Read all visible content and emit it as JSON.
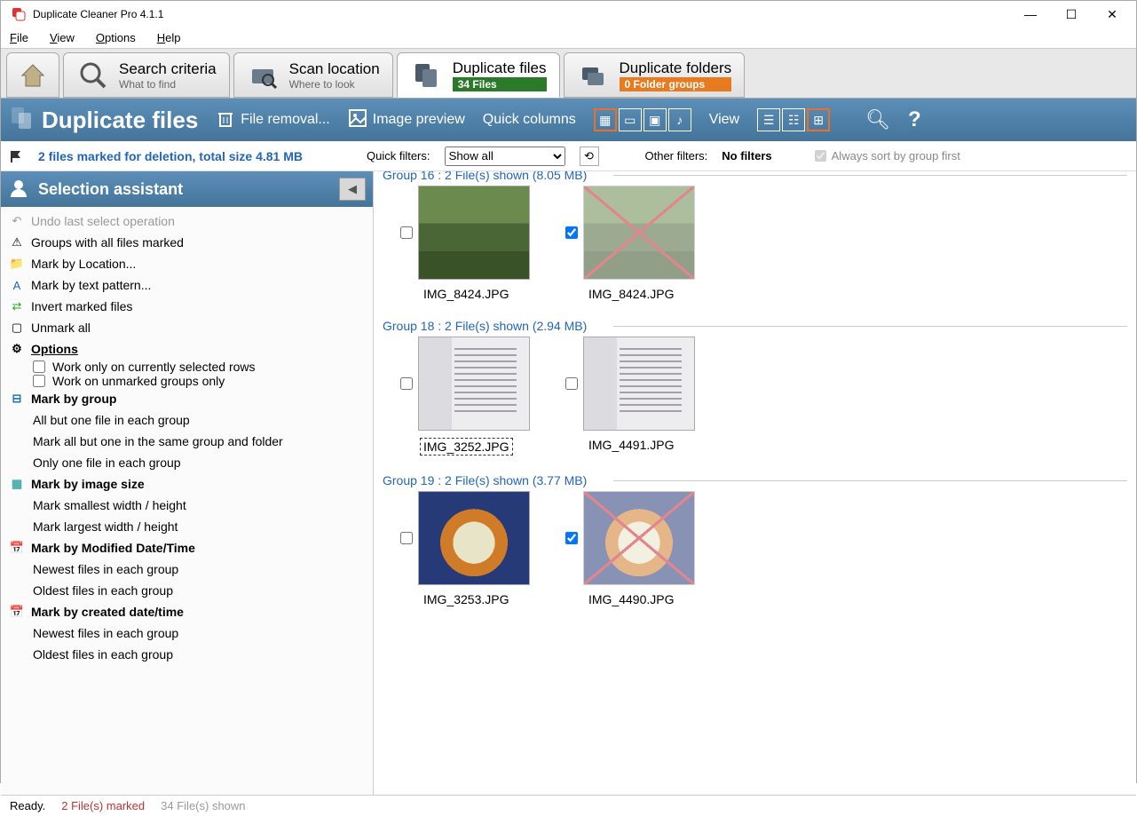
{
  "window": {
    "title": "Duplicate Cleaner Pro 4.1.1"
  },
  "menu": {
    "file": "File",
    "view": "View",
    "options": "Options",
    "help": "Help"
  },
  "tabs": {
    "search": {
      "title": "Search criteria",
      "sub": "What to find"
    },
    "scan": {
      "title": "Scan location",
      "sub": "Where to look"
    },
    "dupfiles": {
      "title": "Duplicate files",
      "badge": "34 Files"
    },
    "dupfolders": {
      "title": "Duplicate folders",
      "badge": "0 Folder groups"
    }
  },
  "bluebar": {
    "title": "Duplicate files",
    "file_removal": "File removal...",
    "image_preview": "Image preview",
    "quick_columns": "Quick columns",
    "view": "View"
  },
  "filterbar": {
    "marked": "2 files marked for deletion, total size 4.81 MB",
    "quick_filters": "Quick filters:",
    "show_all": "Show all",
    "other_filters": "Other filters:",
    "no_filters": "No filters",
    "always_sort": "Always sort by group first"
  },
  "assistant": {
    "title": "Selection assistant",
    "undo": "Undo last select operation",
    "groups_all": "Groups with all files marked",
    "mark_location": "Mark by Location...",
    "mark_text": "Mark by text pattern...",
    "invert": "Invert marked files",
    "unmark": "Unmark all",
    "options": "Options",
    "opt1": "Work only on currently selected rows",
    "opt2": "Work on unmarked groups only",
    "mark_group": "Mark by group",
    "mg1": "All but one file in each group",
    "mg2": "Mark all but one in the same group and folder",
    "mg3": "Only one file in each group",
    "mark_img": "Mark by image size",
    "mi1": "Mark smallest width / height",
    "mi2": "Mark largest width / height",
    "mark_mod": "Mark by Modified Date/Time",
    "mm1": "Newest files in each group",
    "mm2": "Oldest files in each group",
    "mark_cre": "Mark by created date/time",
    "mc1": "Newest files in each group",
    "mc2": "Oldest files in each group"
  },
  "groups": [
    {
      "title": "Group 16  :  2 File(s) shown (8.05 MB)",
      "partial": true,
      "items": [
        {
          "name": "IMG_8424.JPG",
          "marked": false,
          "fill": "fill-garden"
        },
        {
          "name": "IMG_8424.JPG",
          "marked": true,
          "fill": "fill-garden"
        }
      ]
    },
    {
      "title": "Group 18  :  2 File(s) shown (2.94 MB)",
      "items": [
        {
          "name": "IMG_3252.JPG",
          "marked": false,
          "fill": "fill-doc",
          "selected": true
        },
        {
          "name": "IMG_4491.JPG",
          "marked": false,
          "fill": "fill-doc"
        }
      ]
    },
    {
      "title": "Group 19  :  2 File(s) shown (3.77 MB)",
      "items": [
        {
          "name": "IMG_3253.JPG",
          "marked": false,
          "fill": "fill-food"
        },
        {
          "name": "IMG_4490.JPG",
          "marked": true,
          "fill": "fill-food"
        }
      ]
    }
  ],
  "status": {
    "ready": "Ready.",
    "marked": "2 File(s) marked",
    "shown": "34 File(s) shown"
  }
}
